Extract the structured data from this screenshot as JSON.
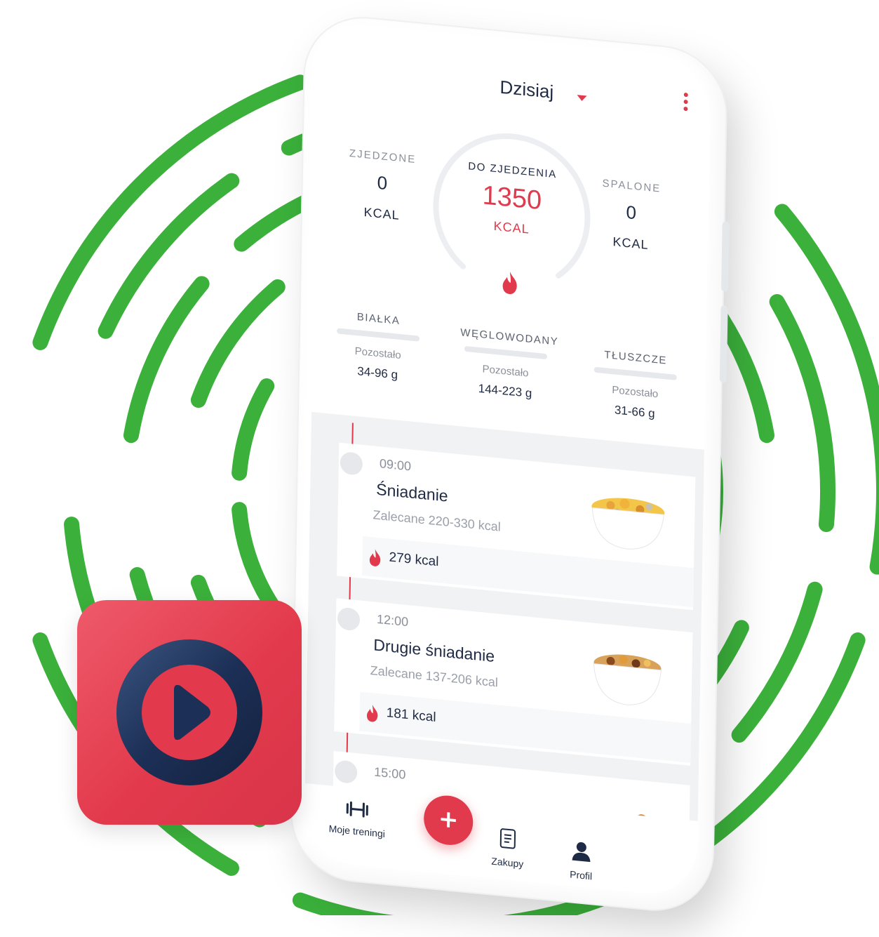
{
  "colors": {
    "accent": "#e03a4c",
    "rings": "#3bb13b",
    "text_dark": "#1f2a44",
    "text_muted": "#8a8f99",
    "app_icon_bg": "#e23a4c",
    "app_icon_ring": "#1c2f56"
  },
  "header": {
    "title": "Dzisiaj",
    "dropdown_icon": "caret-down-icon",
    "menu_icon": "more-vertical-icon"
  },
  "calories": {
    "eaten": {
      "label": "ZJEDZONE",
      "value": "0",
      "unit": "KCAL"
    },
    "remaining": {
      "label": "DO ZJEDZENIA",
      "value": "1350",
      "unit": "KCAL",
      "icon": "flame-icon"
    },
    "burned": {
      "label": "SPALONE",
      "value": "0",
      "unit": "KCAL"
    }
  },
  "macros": [
    {
      "name": "BIAŁKA",
      "left_label": "Pozostało",
      "amount": "34-96 g"
    },
    {
      "name": "WĘGLOWODANY",
      "left_label": "Pozostało",
      "amount": "144-223 g"
    },
    {
      "name": "TŁUSZCZE",
      "left_label": "Pozostało",
      "amount": "31-66 g"
    }
  ],
  "meals": [
    {
      "time": "09:00",
      "title": "Śniadanie",
      "recommended": "Zalecane 220-330 kcal",
      "kcal": "279 kcal",
      "image": "muesli-bowl"
    },
    {
      "time": "12:00",
      "title": "Drugie śniadanie",
      "recommended": "Zalecane 137-206 kcal",
      "kcal": "181 kcal",
      "image": "nuts-bowl"
    },
    {
      "time": "15:00",
      "image": "salad"
    }
  ],
  "nav": {
    "trainings": {
      "label": "Moje treningi",
      "icon": "dumbbell-icon"
    },
    "add": {
      "label": "+",
      "icon": "plus-icon"
    },
    "shopping": {
      "label": "Zakupy",
      "icon": "shopping-list-icon"
    },
    "profile": {
      "label": "Profil",
      "icon": "user-icon"
    }
  },
  "app_icon": {
    "icon": "play-circle-icon"
  }
}
